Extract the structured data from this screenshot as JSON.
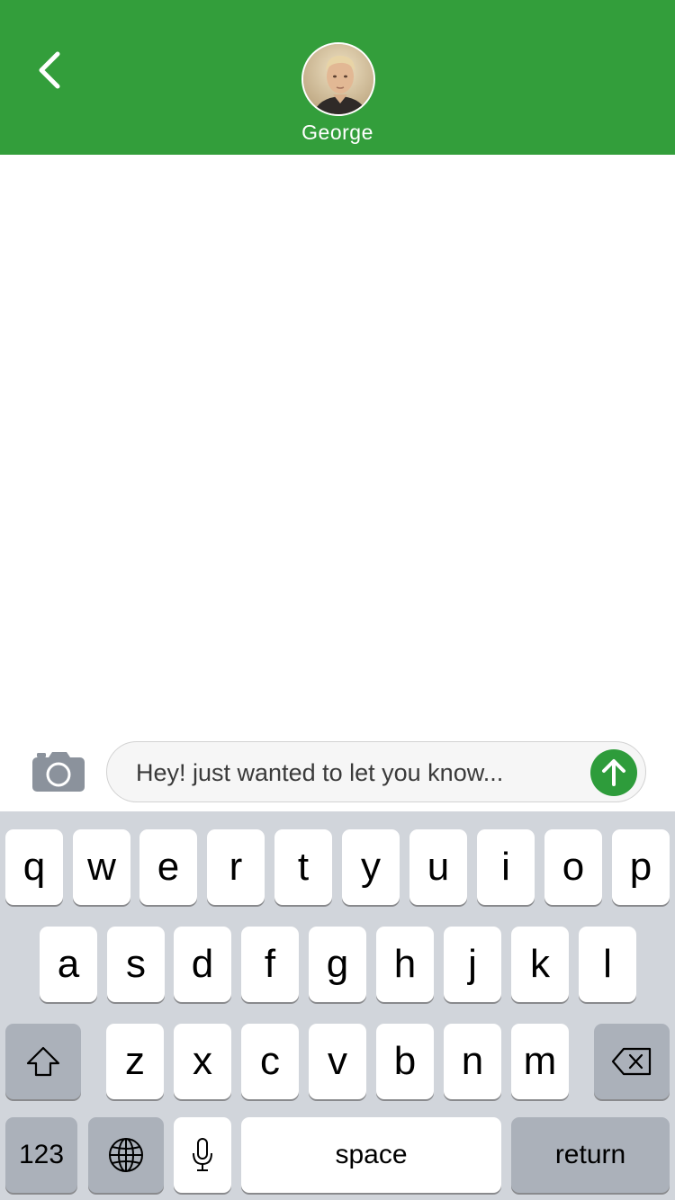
{
  "header": {
    "contact_name": "George",
    "background_color": "#339e3b",
    "back_icon": "chevron-left-icon",
    "avatar": "contact-avatar-photo"
  },
  "composer": {
    "camera_icon": "camera-icon",
    "message_text": "Hey! just wanted to let you know...",
    "send_icon": "arrow-up-icon",
    "send_color": "#2e9c3b"
  },
  "keyboard": {
    "row1": [
      "q",
      "w",
      "e",
      "r",
      "t",
      "y",
      "u",
      "i",
      "o",
      "p"
    ],
    "row2": [
      "a",
      "s",
      "d",
      "f",
      "g",
      "h",
      "j",
      "k",
      "l"
    ],
    "row3": [
      "z",
      "x",
      "c",
      "v",
      "b",
      "n",
      "m"
    ],
    "shift_icon": "shift-icon",
    "delete_icon": "backspace-icon",
    "numbers_label": "123",
    "globe_icon": "globe-icon",
    "mic_icon": "microphone-icon",
    "space_label": "space",
    "return_label": "return"
  }
}
